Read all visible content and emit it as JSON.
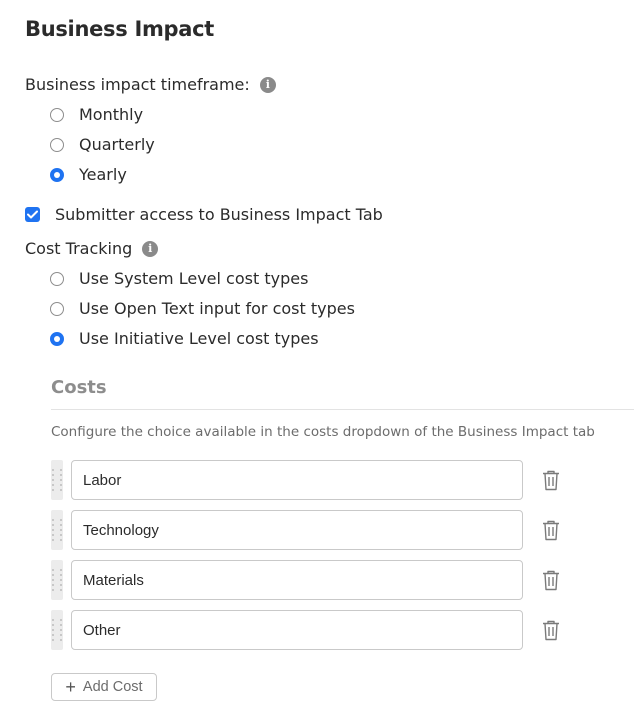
{
  "page_title": "Business Impact",
  "timeframe": {
    "label": "Business impact timeframe:",
    "info_icon": "info-icon",
    "options": [
      {
        "label": "Monthly",
        "checked": false
      },
      {
        "label": "Quarterly",
        "checked": false
      },
      {
        "label": "Yearly",
        "checked": true
      }
    ]
  },
  "submitter_access": {
    "label": "Submitter access to Business Impact Tab",
    "checked": true
  },
  "cost_tracking": {
    "label": "Cost Tracking",
    "info_icon": "info-icon",
    "options": [
      {
        "label": "Use System Level cost types",
        "checked": false
      },
      {
        "label": "Use Open Text input for cost types",
        "checked": false
      },
      {
        "label": "Use Initiative Level cost types",
        "checked": true
      }
    ]
  },
  "costs": {
    "title": "Costs",
    "description": "Configure the choice available in the costs dropdown of the Business Impact tab",
    "items": [
      {
        "value": "Labor"
      },
      {
        "value": "Technology"
      },
      {
        "value": "Materials"
      },
      {
        "value": "Other"
      }
    ],
    "add_label": "Add Cost"
  },
  "colors": {
    "accent": "#1f73f1",
    "muted": "#8d8d8d"
  }
}
